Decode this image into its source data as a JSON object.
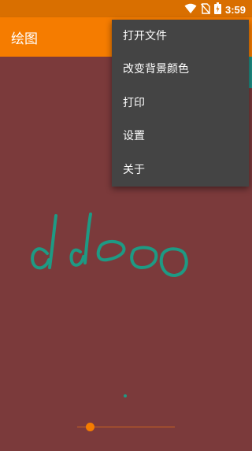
{
  "status_bar": {
    "time": "3:59"
  },
  "app_bar": {
    "title": "绘图"
  },
  "menu": {
    "items": [
      {
        "label": "打开文件"
      },
      {
        "label": "改变背景颜色"
      },
      {
        "label": "打印"
      },
      {
        "label": "设置"
      },
      {
        "label": "关于"
      }
    ]
  },
  "canvas": {
    "background_color": "#7b3a3b",
    "stroke_color": "#1e9a84"
  },
  "brush_size_slider": {
    "value_fraction": 0.1
  },
  "icons": [
    "wifi-icon",
    "no-sim-icon",
    "battery-icon"
  ]
}
